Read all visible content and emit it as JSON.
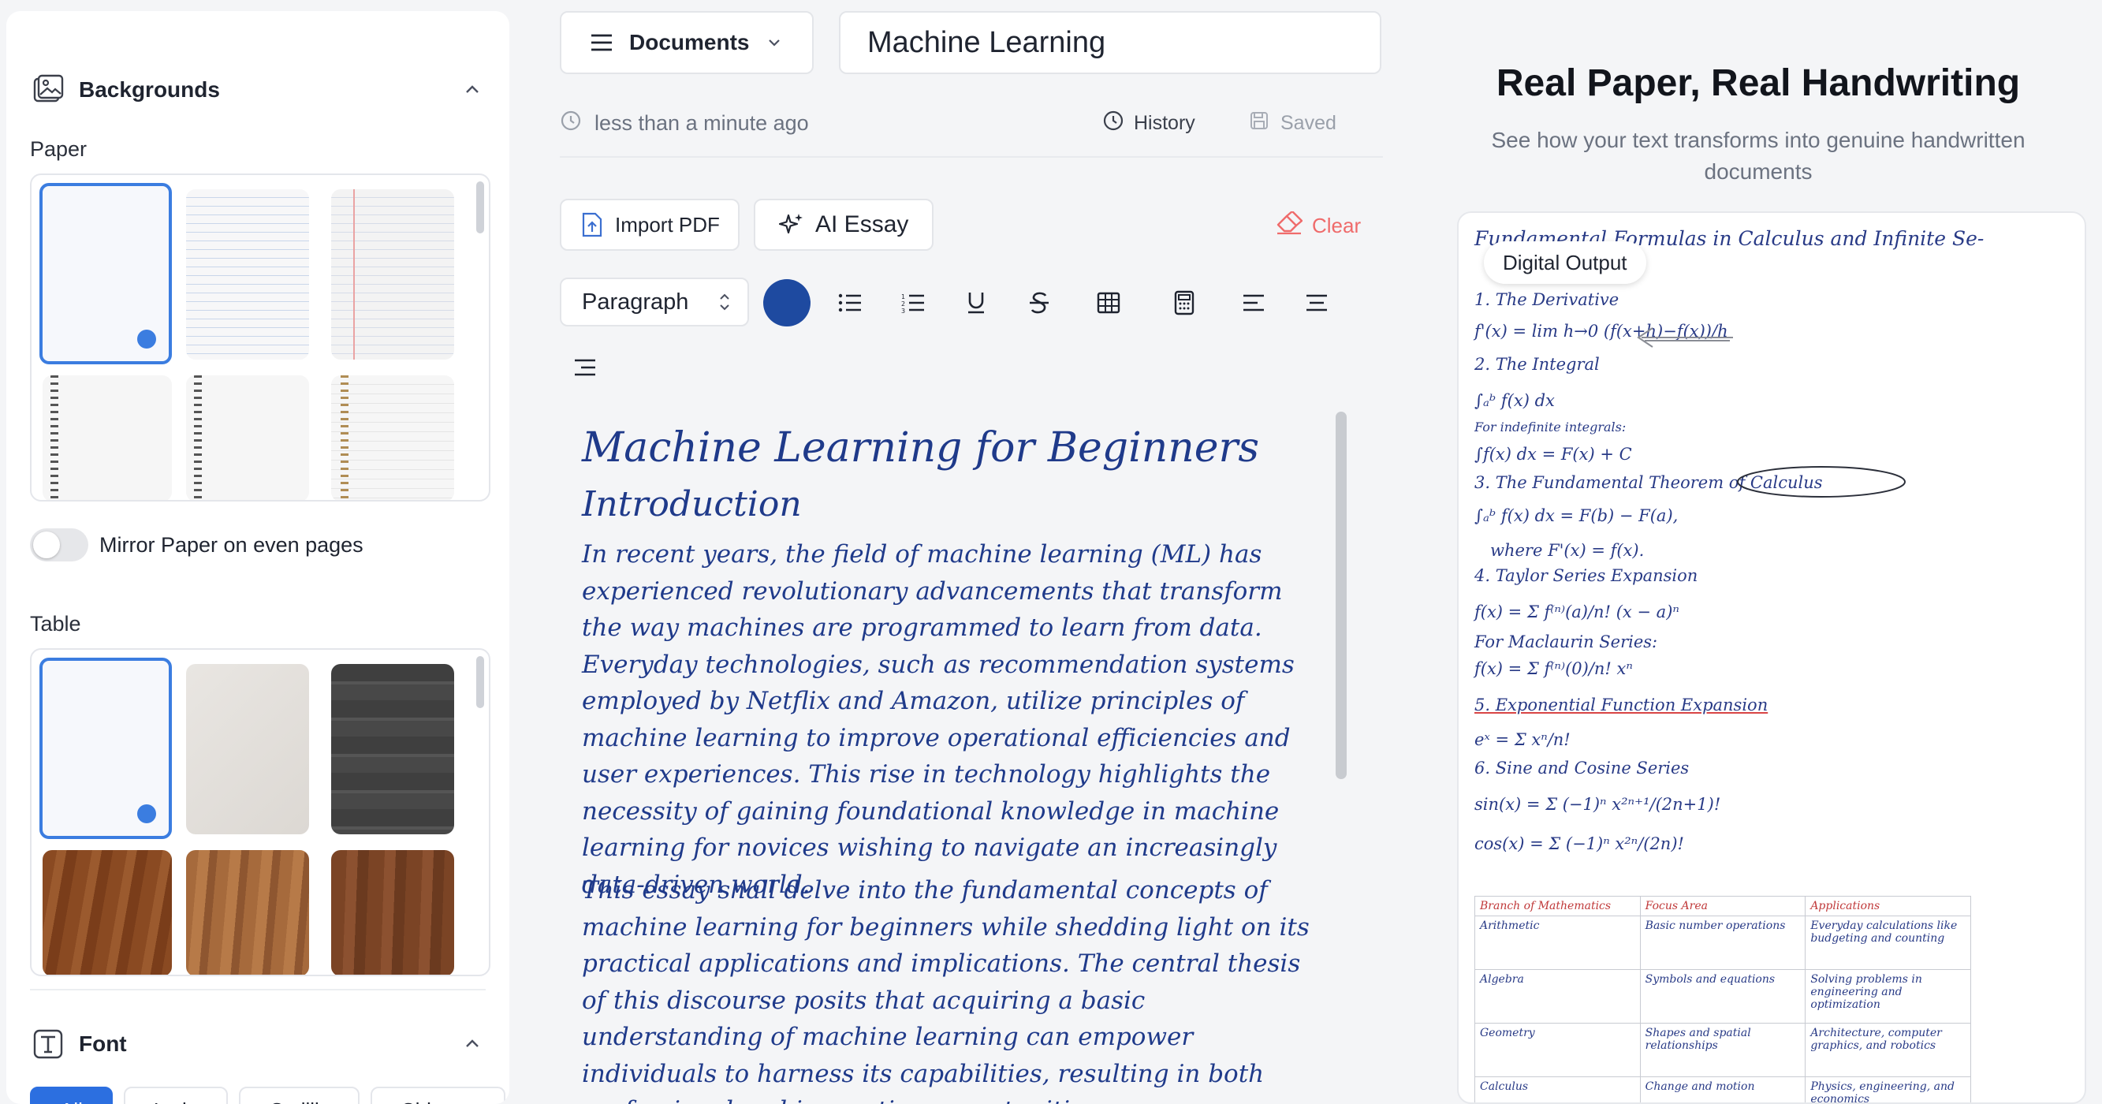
{
  "sidebar": {
    "backgrounds": {
      "title": "Backgrounds",
      "paper_label": "Paper",
      "mirror_label": "Mirror Paper on even pages",
      "table_label": "Table"
    },
    "font": {
      "title": "Font",
      "chips": [
        "All",
        "Latin",
        "Cyrillic",
        "Chinese"
      ]
    }
  },
  "toolbar": {
    "documents_label": "Documents",
    "title_value": "Machine Learning",
    "last_saved": "less than a minute ago",
    "history_label": "History",
    "saved_label": "Saved",
    "import_pdf_label": "Import PDF",
    "ai_essay_label": "AI Essay",
    "clear_label": "Clear",
    "block_type": "Paragraph",
    "ink_color": "#1e4aa0"
  },
  "document": {
    "heading": "Machine Learning for Beginners",
    "subheading": "Introduction",
    "paragraph1": "In recent years, the field of machine learning (ML) has experienced revolutionary advancements that transform the way machines are programmed to learn from data. Everyday technologies, such as recommendation systems employed by Netflix and Amazon, utilize principles of machine learning to improve operational efficiencies and user experiences. This rise in technology highlights the necessity of gaining foundational knowledge in machine learning for novices wishing to navigate an increasingly data-driven world.",
    "paragraph2": "This essay shall delve into the fundamental concepts of machine learning for beginners while shedding light on its practical applications and implications. The central thesis of this discourse posits that acquiring a basic understanding of machine learning can empower individuals to harness its capabilities, resulting in both professional and innovative opportunities."
  },
  "preview": {
    "title": "Real Paper, Real Handwriting",
    "subtitle": "See how your text transforms into genuine handwritten documents",
    "badge": "Digital Output",
    "lines": {
      "heading": "Fundamental Formulas in Calculus and Infinite Se-",
      "l1": "1. The Derivative",
      "l2": "f'(x) = lim h→0 (f(x+h)−f(x))/h",
      "l3": "2. The Integral",
      "l4": "∫ₐᵇ f(x) dx",
      "l5": "For indefinite integrals:",
      "l6": "∫f(x) dx = F(x) + C",
      "l7": "3. The Fundamental Theorem of Calculus",
      "l8": "∫ₐᵇ f(x) dx = F(b) − F(a),",
      "l9": "where F'(x) = f(x).",
      "l10": "4. Taylor Series Expansion",
      "l11": "f(x) = Σ f⁽ⁿ⁾(a)/n! (x − a)ⁿ",
      "l12": "For Maclaurin Series:",
      "l13": "f(x) = Σ f⁽ⁿ⁾(0)/n! xⁿ",
      "l14": "5. Exponential Function Expansion",
      "l15": "eˣ = Σ xⁿ/n!",
      "l16": "6. Sine and Cosine Series",
      "l17": "sin(x) = Σ (−1)ⁿ x²ⁿ⁺¹/(2n+1)!",
      "l18": "cos(x) = Σ (−1)ⁿ x²ⁿ/(2n)!"
    },
    "table": {
      "headers": [
        "Branch of Mathematics",
        "Focus Area",
        "Applications"
      ],
      "rows": [
        [
          "Arithmetic",
          "Basic number operations",
          "Everyday calculations like budgeting and counting"
        ],
        [
          "Algebra",
          "Symbols and equations",
          "Solving problems in engineering and optimization"
        ],
        [
          "Geometry",
          "Shapes and spatial relationships",
          "Architecture, computer graphics, and robotics"
        ],
        [
          "Calculus",
          "Change and motion",
          "Physics, engineering, and economics"
        ]
      ]
    }
  }
}
